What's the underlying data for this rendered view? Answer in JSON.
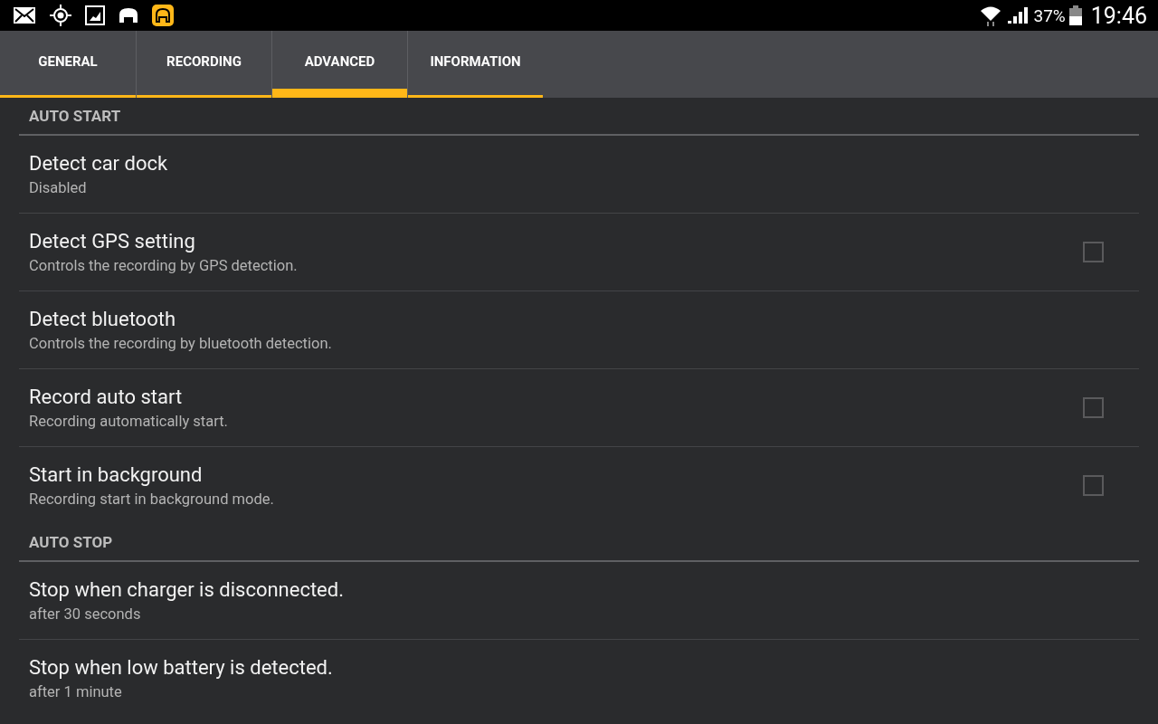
{
  "status_bar": {
    "battery_text": "37%",
    "time": "19:46"
  },
  "tabs": [
    {
      "label": "GENERAL",
      "selected": false
    },
    {
      "label": "RECORDING",
      "selected": false
    },
    {
      "label": "ADVANCED",
      "selected": true
    },
    {
      "label": "INFORMATION",
      "selected": false
    }
  ],
  "sections": [
    {
      "title": "AUTO START",
      "items": [
        {
          "kind": "plain",
          "title": "Detect car dock",
          "summary": "Disabled"
        },
        {
          "kind": "checkbox",
          "title": "Detect GPS setting",
          "summary": "Controls the recording by GPS detection.",
          "checked": false
        },
        {
          "kind": "plain",
          "title": "Detect bluetooth",
          "summary": "Controls the recording by bluetooth detection."
        },
        {
          "kind": "checkbox",
          "title": "Record auto start",
          "summary": "Recording automatically start.",
          "checked": false
        },
        {
          "kind": "checkbox",
          "title": "Start in background",
          "summary": "Recording start in background mode.",
          "checked": false
        }
      ]
    },
    {
      "title": "AUTO STOP",
      "items": [
        {
          "kind": "plain",
          "title": "Stop when charger is disconnected.",
          "summary": "after 30 seconds"
        },
        {
          "kind": "plain",
          "title": "Stop when low battery is detected.",
          "summary": "after 1 minute"
        }
      ]
    }
  ]
}
